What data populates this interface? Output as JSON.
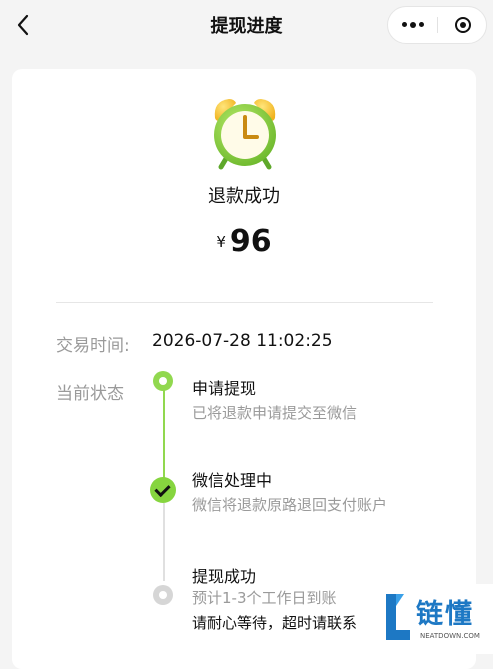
{
  "navbar": {
    "title": "提现进度",
    "more_icon": "more-dots-icon",
    "close_icon": "target-close-icon"
  },
  "status": {
    "icon": "alarm-clock-icon",
    "title": "退款成功",
    "currency": "¥",
    "amount": "96"
  },
  "transaction": {
    "time_label": "交易时间:",
    "time_value": "2026-07-28 11:02:25",
    "state_label": "当前状态"
  },
  "steps": [
    {
      "title": "申请提现",
      "desc": "已将退款申请提交至微信",
      "state": "done"
    },
    {
      "title": "微信处理中",
      "desc": "微信将退款原路退回支付账户",
      "state": "current"
    },
    {
      "title": "提现成功",
      "desc": "预计1-3个工作日到账",
      "note": "请耐心等待，超时请联系",
      "state": "pending"
    }
  ],
  "watermark": {
    "text": "链懂",
    "sub": "NEATDOWN.COM"
  },
  "colors": {
    "accent_green": "#91d84f",
    "inactive_gray": "#d6d6d6",
    "watermark_blue": "#1d78c4"
  }
}
